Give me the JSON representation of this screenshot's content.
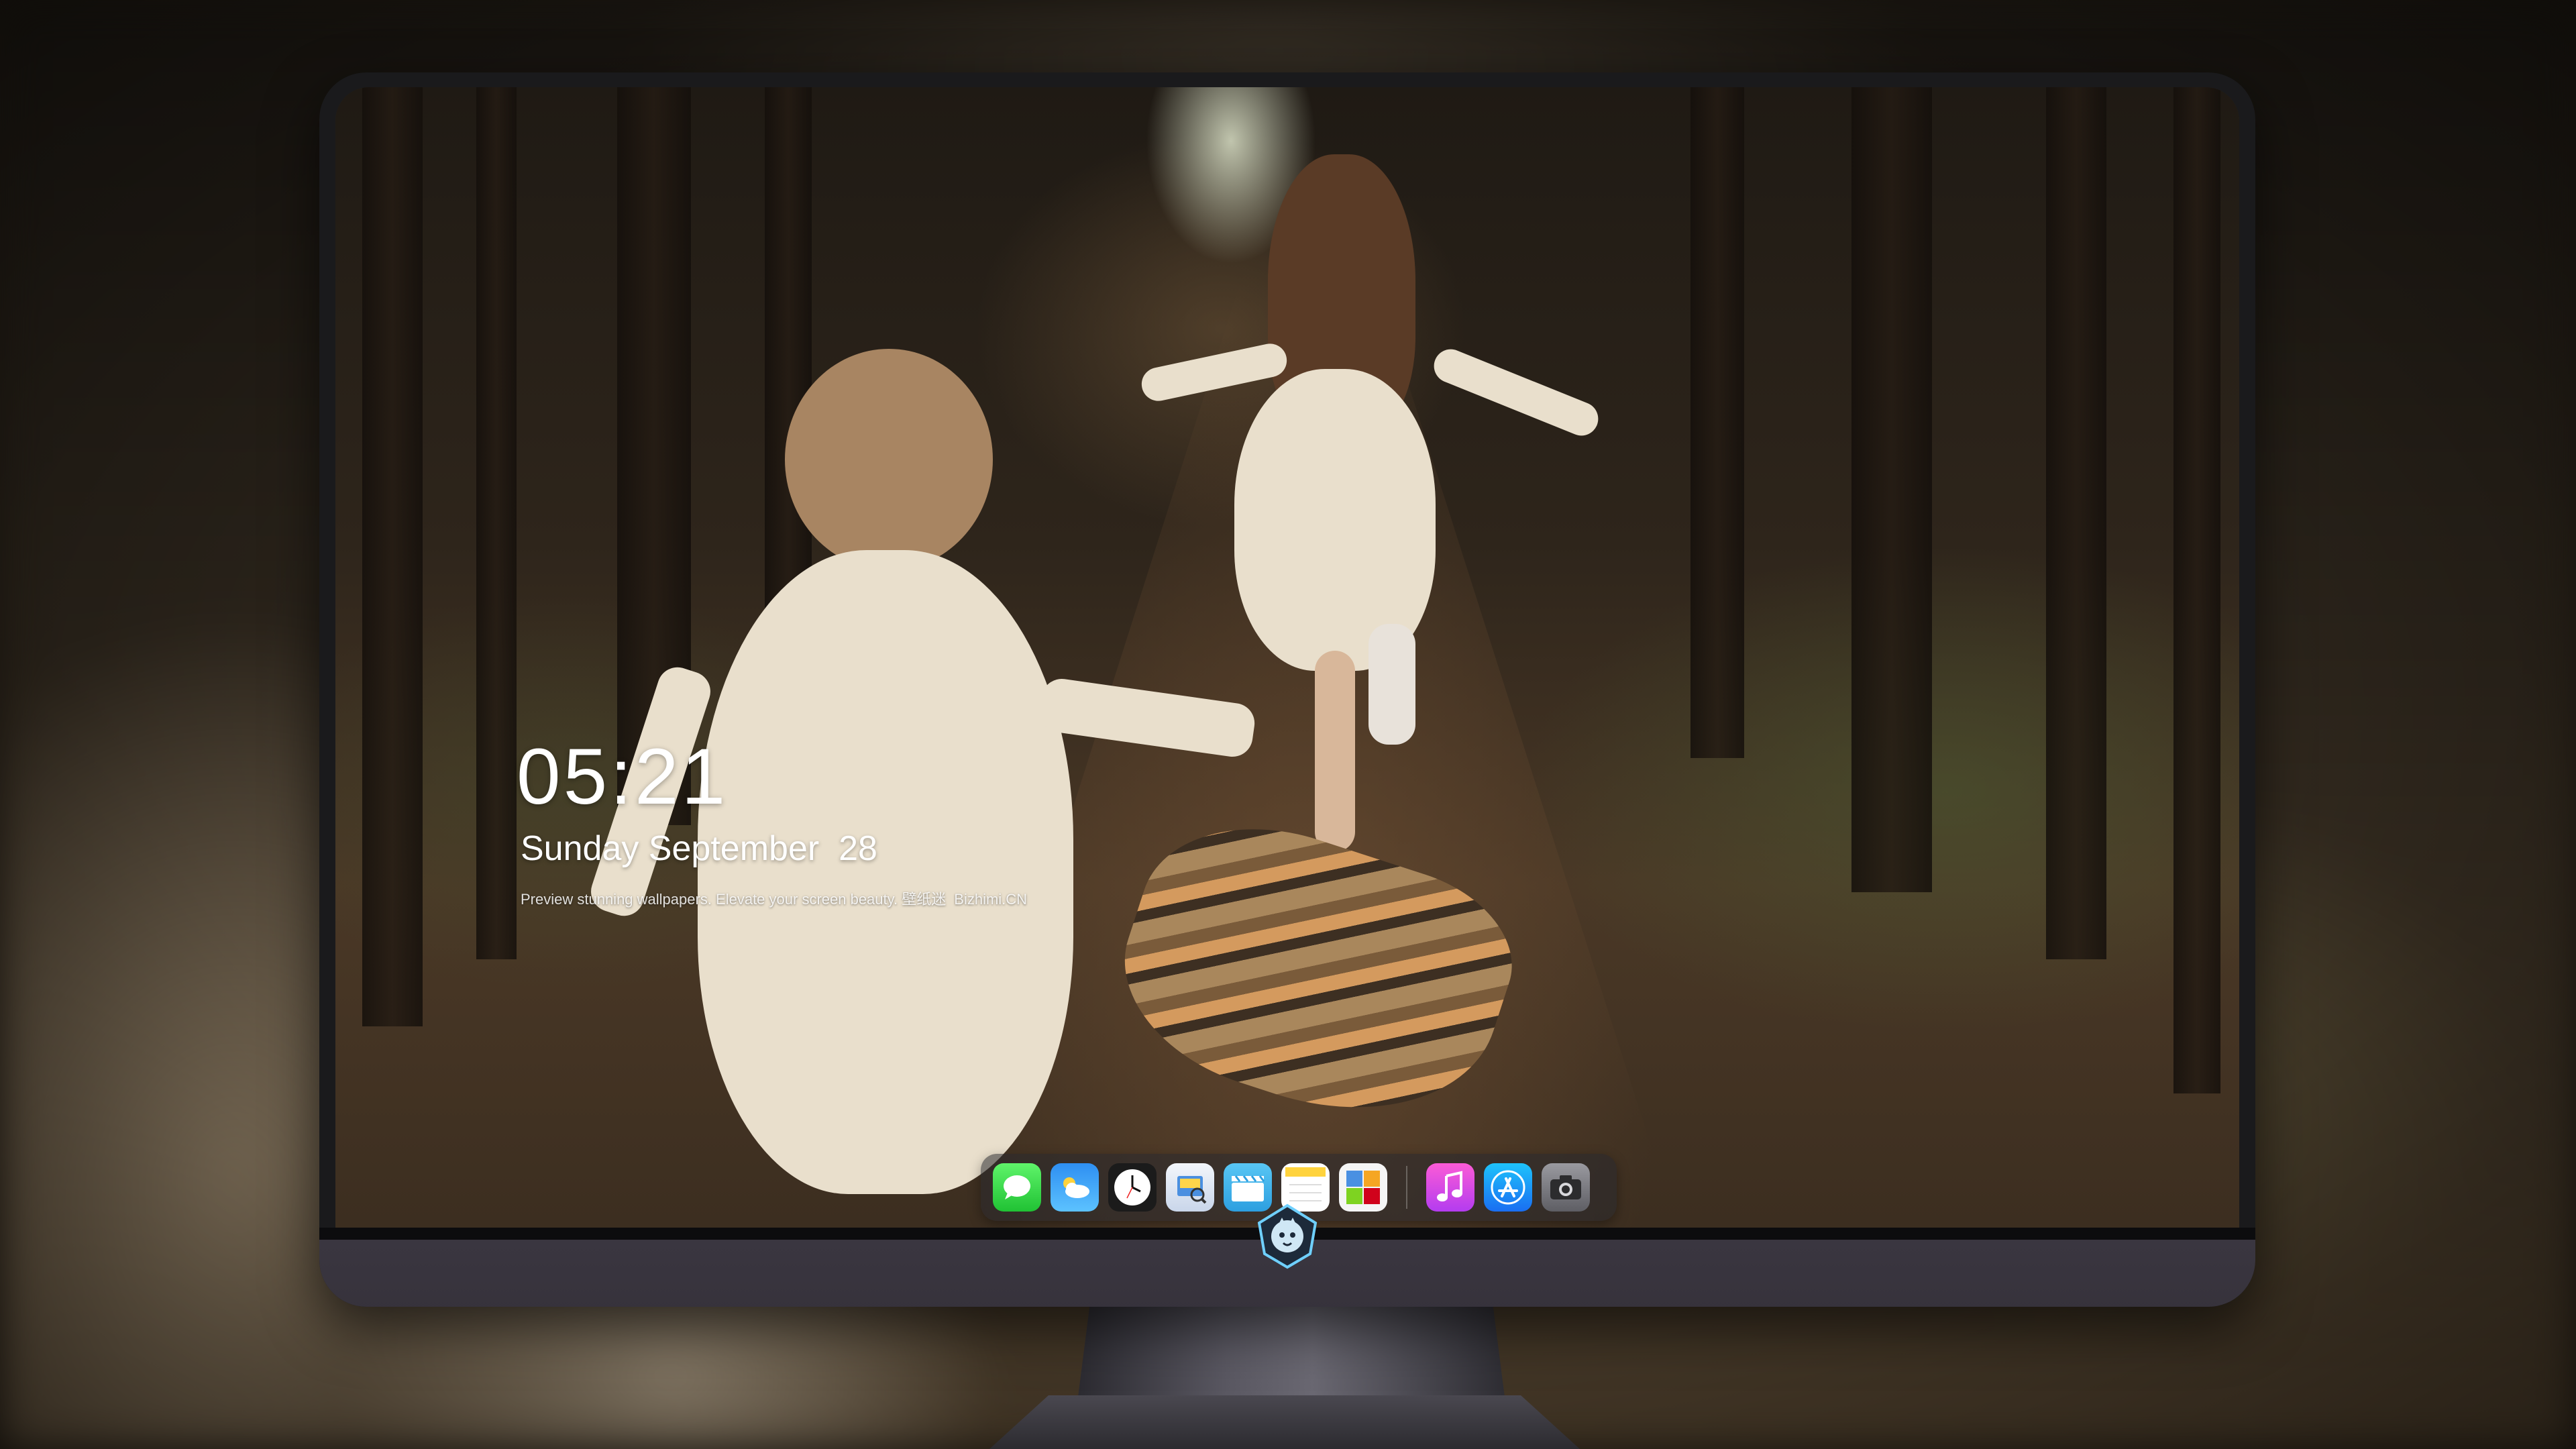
{
  "lockscreen": {
    "time": "05:21",
    "date": "Sunday September  28",
    "caption_text": "Preview stunning wallpapers. Elevate your screen beauty.",
    "caption_link": "壁纸迷",
    "caption_site": "Bizhimi.CN"
  },
  "dock": {
    "apps": [
      {
        "name": "Messages",
        "icon": "messages-icon"
      },
      {
        "name": "Weather",
        "icon": "weather-icon"
      },
      {
        "name": "Clock",
        "icon": "clock-icon"
      },
      {
        "name": "Preview",
        "icon": "preview-icon"
      },
      {
        "name": "Clips",
        "icon": "clips-icon"
      },
      {
        "name": "Notes",
        "icon": "notes-icon"
      },
      {
        "name": "Photo Booth",
        "icon": "photo-booth-icon"
      },
      {
        "name": "Music",
        "icon": "music-icon"
      },
      {
        "name": "App Store",
        "icon": "app-store-icon"
      },
      {
        "name": "Camera",
        "icon": "camera-icon"
      }
    ]
  },
  "colors": {
    "chin": "#3a3640",
    "bezel": "#1a1a1c",
    "text": "#ffffff"
  }
}
